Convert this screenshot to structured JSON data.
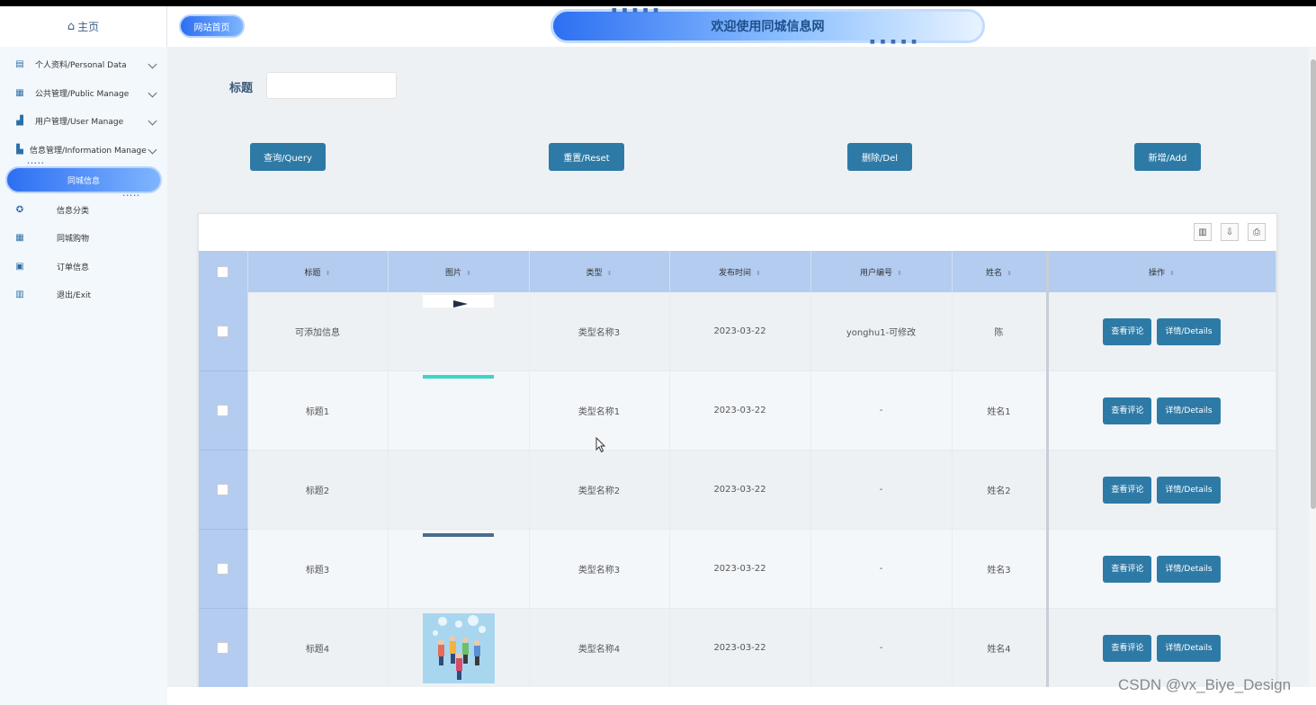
{
  "sidebar": {
    "home": "主页",
    "items": [
      {
        "label": "个人资料/Personal Data",
        "icon": "document-icon",
        "expandable": true
      },
      {
        "label": "公共管理/Public Manage",
        "icon": "clipboard-icon",
        "expandable": true
      },
      {
        "label": "用户管理/User Manage",
        "icon": "chart-icon",
        "expandable": true
      },
      {
        "label": "信息管理/Information Manage",
        "icon": "bar-chart-icon",
        "expandable": true
      }
    ],
    "subitems": [
      {
        "label": "同城信息",
        "active": true
      },
      {
        "label": "信息分类",
        "icon": "award-icon"
      },
      {
        "label": "同城购物",
        "icon": "calendar-icon"
      },
      {
        "label": "订单信息",
        "icon": "calendar-check-icon"
      },
      {
        "label": "退出/Exit",
        "icon": "book-icon"
      }
    ]
  },
  "header": {
    "site_home": "网站首页",
    "title": "欢迎使用同城信息网"
  },
  "search": {
    "label": "标题",
    "value": ""
  },
  "toolbar": {
    "query": "查询/Query",
    "reset": "重置/Reset",
    "delete": "删除/Del",
    "add": "新增/Add"
  },
  "table": {
    "columns": [
      "标题",
      "图片",
      "类型",
      "发布时间",
      "用户编号",
      "姓名",
      "操作"
    ],
    "rows": [
      {
        "title": "可添加信息",
        "type": "类型名称3",
        "date": "2023-03-22",
        "user_id": "yonghu1-可修改",
        "name": "陈"
      },
      {
        "title": "标题1",
        "type": "类型名称1",
        "date": "2023-03-22",
        "user_id": "-",
        "name": "姓名1"
      },
      {
        "title": "标题2",
        "type": "类型名称2",
        "date": "2023-03-22",
        "user_id": "-",
        "name": "姓名2"
      },
      {
        "title": "标题3",
        "type": "类型名称3",
        "date": "2023-03-22",
        "user_id": "-",
        "name": "姓名3"
      },
      {
        "title": "标题4",
        "type": "类型名称4",
        "date": "2023-03-22",
        "user_id": "-",
        "name": "姓名4"
      }
    ],
    "row_actions": {
      "comments": "查看评论",
      "details": "详情/Details"
    }
  },
  "watermark": "CSDN @vx_Biye_Design",
  "colors": {
    "primary_button": "#2e7aa6",
    "header_row": "#b3ccf0",
    "pill_gradient_start": "#2d6ff2",
    "pill_gradient_end": "#7fb5ff"
  }
}
